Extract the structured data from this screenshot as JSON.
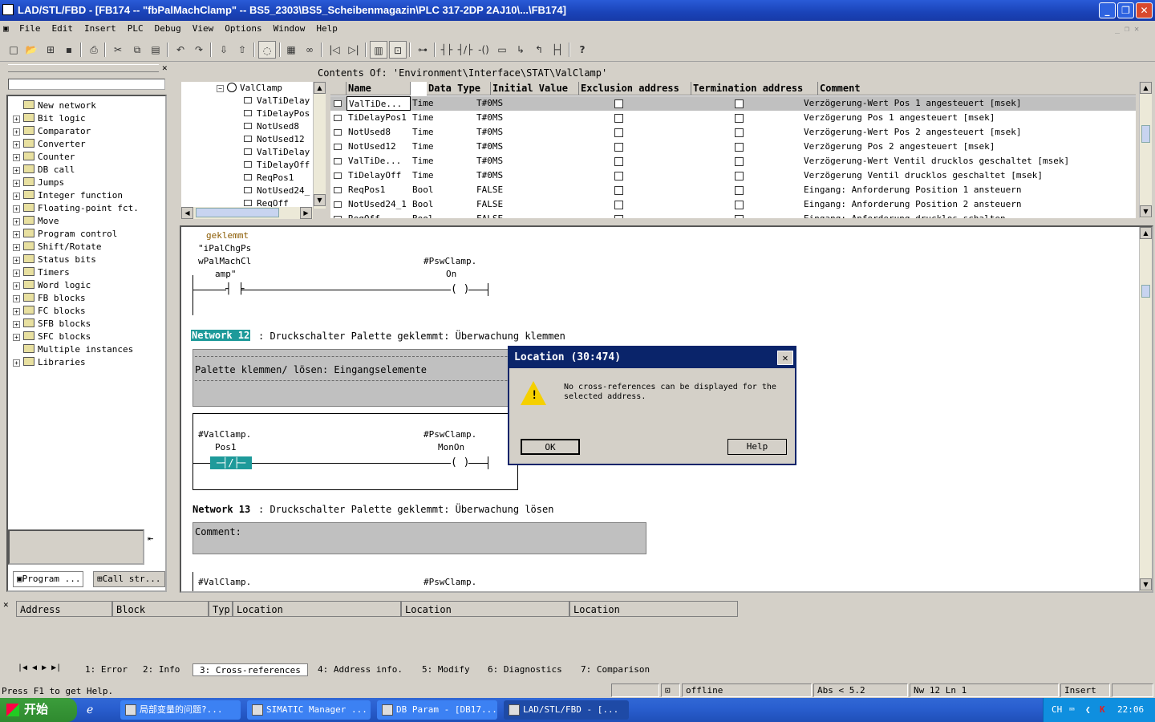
{
  "window": {
    "title": "LAD/STL/FBD  - [FB174 -- \"fbPalMachClamp\" -- BS5_2303\\BS5_Scheibenmagazin\\PLC 317-2DP 2AJ10\\...\\FB174]"
  },
  "menu": [
    "File",
    "Edit",
    "Insert",
    "PLC",
    "Debug",
    "View",
    "Options",
    "Window",
    "Help"
  ],
  "toolbar": {
    "help_label": "?"
  },
  "catalog": {
    "items": [
      {
        "label": "New network",
        "expandable": false
      },
      {
        "label": "Bit logic",
        "expandable": true
      },
      {
        "label": "Comparator",
        "expandable": true
      },
      {
        "label": "Converter",
        "expandable": true
      },
      {
        "label": "Counter",
        "expandable": true
      },
      {
        "label": "DB call",
        "expandable": true
      },
      {
        "label": "Jumps",
        "expandable": true
      },
      {
        "label": "Integer function",
        "expandable": true
      },
      {
        "label": "Floating-point fct.",
        "expandable": true
      },
      {
        "label": "Move",
        "expandable": true
      },
      {
        "label": "Program control",
        "expandable": true
      },
      {
        "label": "Shift/Rotate",
        "expandable": true
      },
      {
        "label": "Status bits",
        "expandable": true
      },
      {
        "label": "Timers",
        "expandable": true
      },
      {
        "label": "Word logic",
        "expandable": true
      },
      {
        "label": "FB blocks",
        "expandable": true
      },
      {
        "label": "FC blocks",
        "expandable": true
      },
      {
        "label": "SFB blocks",
        "expandable": true
      },
      {
        "label": "SFC blocks",
        "expandable": true
      },
      {
        "label": "Multiple instances",
        "expandable": false
      },
      {
        "label": "Libraries",
        "expandable": true
      }
    ],
    "tabs": [
      "Program ...",
      "Call str..."
    ]
  },
  "interface": {
    "contents_label": "Contents Of: 'Environment\\Interface\\STAT\\ValClamp'",
    "tree_root": "ValClamp",
    "tree_items": [
      "ValTiDelay",
      "TiDelayPos",
      "NotUsed8",
      "NotUsed12",
      "ValTiDelay",
      "TiDelayOff",
      "ReqPos1",
      "NotUsed24_",
      "ReqOff"
    ],
    "columns": [
      "Name",
      "Data Type",
      "Initial Value",
      "Exclusion address",
      "Termination address",
      "Comment"
    ],
    "rows": [
      {
        "name": "ValTiDe...",
        "type": "Time",
        "initial": "T#0MS",
        "comment": "Verzögerung-Wert Pos 1 angesteuert [msek]",
        "selected": true
      },
      {
        "name": "TiDelayPos1",
        "type": "Time",
        "initial": "T#0MS",
        "comment": "Verzögerung Pos 1 angesteuert [msek]",
        "selected": false
      },
      {
        "name": "NotUsed8",
        "type": "Time",
        "initial": "T#0MS",
        "comment": "Verzögerung-Wert Pos 2 angesteuert [msek]",
        "selected": false
      },
      {
        "name": "NotUsed12",
        "type": "Time",
        "initial": "T#0MS",
        "comment": "Verzögerung Pos 2 angesteuert [msek]",
        "selected": false
      },
      {
        "name": "ValTiDe...",
        "type": "Time",
        "initial": "T#0MS",
        "comment": "Verzögerung-Wert Ventil drucklos geschaltet [msek]",
        "selected": false
      },
      {
        "name": "TiDelayOff",
        "type": "Time",
        "initial": "T#0MS",
        "comment": "Verzögerung Ventil drucklos geschaltet [msek]",
        "selected": false
      },
      {
        "name": "ReqPos1",
        "type": "Bool",
        "initial": "FALSE",
        "comment": "Eingang: Anforderung Position 1 ansteuern",
        "selected": false
      },
      {
        "name": "NotUsed24_1",
        "type": "Bool",
        "initial": "FALSE",
        "comment": "Eingang: Anforderung Position 2 ansteuern",
        "selected": false
      },
      {
        "name": "ReqOff",
        "type": "Bool",
        "initial": "FALSE",
        "comment": "Eingang: Anforderung drucklos schalten",
        "selected": false
      }
    ]
  },
  "editor": {
    "n11_label1": "geklemmt",
    "n11_contact_a": "\"iPalChgPs",
    "n11_contact_b": "wPalMachCl",
    "n11_contact_c": "amp\"",
    "n11_coil_a": "#PswClamp.",
    "n11_coil_b": "On",
    "n12_title": "Network 12",
    "n12_desc": ": Druckschalter Palette geklemmt: Überwachung klemmen",
    "n12_comment": "Palette klemmen/ lösen: Eingangselemente",
    "n12_contact_a": "#ValClamp.",
    "n12_contact_b": "Pos1",
    "n12_coil_a": "#PswClamp.",
    "n12_coil_b": "MonOn",
    "n13_title": "Network 13",
    "n13_desc": ": Druckschalter Palette geklemmt: Überwachung lösen",
    "n13_comment": "Comment:",
    "n13_contact_a": "#ValClamp.",
    "n13_coil_a": "#PswClamp."
  },
  "dialog": {
    "title": "Location (30:474)",
    "message": "No cross-references can be displayed for the selected address.",
    "ok": "OK",
    "help": "Help"
  },
  "xref": {
    "columns": [
      "Address",
      "Block",
      "Typ",
      "Location",
      "Location",
      "Location"
    ],
    "tabs": [
      "1: Error",
      "2: Info",
      "3: Cross-references",
      "4: Address info.",
      "5: Modify",
      "6: Diagnostics",
      "7: Comparison"
    ],
    "active_tab": "3: Cross-references"
  },
  "status": {
    "help": "Press F1 to get Help.",
    "mode": "offline",
    "abs": "Abs < 5.2",
    "nw": "Nw 12  Ln 1",
    "insert": "Insert"
  },
  "taskbar": {
    "start": "开始",
    "tasks": [
      {
        "label": "局部变量的问题?...",
        "active": false
      },
      {
        "label": "SIMATIC Manager ...",
        "active": false
      },
      {
        "label": "DB Param - [DB17...",
        "active": false
      },
      {
        "label": "LAD/STL/FBD  - [...",
        "active": true
      }
    ],
    "lang": "CH",
    "clock": "22:06"
  },
  "colors": {
    "title": "#1a43b8",
    "selection": "#0a246a",
    "network_highlight": "#1e9a9a"
  }
}
